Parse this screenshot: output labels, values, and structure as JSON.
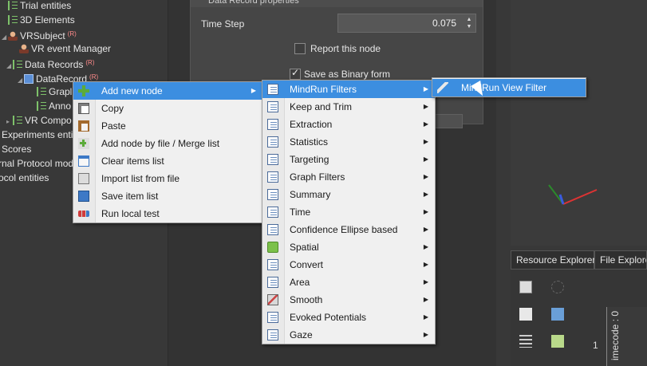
{
  "tree": {
    "items": [
      {
        "label": "Trial entities",
        "icon": "list-icon",
        "sup": ""
      },
      {
        "label": "3D Elements",
        "icon": "list-icon",
        "sup": ""
      },
      {
        "label": "VRSubject",
        "icon": "user-icon",
        "sup": "(R)"
      },
      {
        "label": "VR event Manager",
        "icon": "user-icon",
        "sup": ""
      },
      {
        "label": "Data Records",
        "icon": "list-icon",
        "sup": "(R)"
      },
      {
        "label": "DataRecord",
        "icon": "record-icon",
        "sup": "(R)"
      },
      {
        "label": "Grapl",
        "icon": "list-icon",
        "sup": ""
      },
      {
        "label": "Anno",
        "icon": "list-icon",
        "sup": ""
      },
      {
        "label": "VR Compo",
        "icon": "list-icon",
        "sup": ""
      },
      {
        "label": "Experiments entiti",
        "icon": "",
        "sup": ""
      },
      {
        "label": "Scores",
        "icon": "",
        "sup": ""
      },
      {
        "label": "rnal Protocol mod",
        "icon": "",
        "sup": ""
      },
      {
        "label": "ocol entities",
        "icon": "",
        "sup": ""
      }
    ]
  },
  "props": {
    "header": "Data Record properties",
    "time_step_label": "Time Step",
    "time_step_value": "0.075",
    "report_node_label": "Report this node",
    "report_node_checked": false,
    "binary_label": "Save as Binary form",
    "binary_checked": true
  },
  "context_menu": {
    "items": [
      {
        "label": "Add new node",
        "icon": "add-icon",
        "submenu": true,
        "highlighted": true
      },
      {
        "label": "Copy",
        "icon": "copy-icon",
        "submenu": false,
        "highlighted": false
      },
      {
        "label": "Paste",
        "icon": "paste-icon",
        "submenu": false,
        "highlighted": false
      },
      {
        "label": "Add node by file / Merge list",
        "icon": "add-file-icon",
        "submenu": false,
        "highlighted": false
      },
      {
        "label": "Clear items list",
        "icon": "clear-list-icon",
        "submenu": false,
        "highlighted": false
      },
      {
        "label": "Import list from file",
        "icon": "import-icon",
        "submenu": false,
        "highlighted": false
      },
      {
        "label": "Save item list",
        "icon": "save-icon",
        "submenu": false,
        "highlighted": false
      },
      {
        "label": "Run local test",
        "icon": "run-icon",
        "submenu": false,
        "highlighted": false
      }
    ]
  },
  "node_menu": {
    "items": [
      {
        "label": "MindRun Filters",
        "icon": "node-icon",
        "highlighted": true
      },
      {
        "label": "Keep and Trim",
        "icon": "node-icon",
        "highlighted": false
      },
      {
        "label": "Extraction",
        "icon": "node-icon",
        "highlighted": false
      },
      {
        "label": "Statistics",
        "icon": "node-icon",
        "highlighted": false
      },
      {
        "label": "Targeting",
        "icon": "node-icon",
        "highlighted": false
      },
      {
        "label": "Graph Filters",
        "icon": "node-icon",
        "highlighted": false
      },
      {
        "label": "Summary",
        "icon": "node-icon",
        "highlighted": false
      },
      {
        "label": "Time",
        "icon": "node-icon",
        "highlighted": false
      },
      {
        "label": "Confidence Ellipse based",
        "icon": "node-icon",
        "highlighted": false
      },
      {
        "label": "Spatial",
        "icon": "spatial-icon",
        "highlighted": false
      },
      {
        "label": "Convert",
        "icon": "node-icon",
        "highlighted": false
      },
      {
        "label": "Area",
        "icon": "node-icon",
        "highlighted": false
      },
      {
        "label": "Smooth",
        "icon": "smooth-icon",
        "highlighted": false
      },
      {
        "label": "Evoked Potentials",
        "icon": "node-icon",
        "highlighted": false
      },
      {
        "label": "Gaze",
        "icon": "node-icon",
        "highlighted": false
      }
    ]
  },
  "filter_menu": {
    "items": [
      {
        "label": "MindRun View Filter",
        "icon": "pen-icon",
        "highlighted": true
      }
    ]
  },
  "tabs": [
    {
      "label": "Resource Explorer"
    },
    {
      "label": "File Explore"
    }
  ],
  "timecode": {
    "label": "imecode : 0",
    "value": "1"
  },
  "colors": {
    "highlight": "#3c8ee0",
    "menu_bg": "#f0f0f0",
    "panel_bg": "#383838",
    "accent_red": "#ff8a8a"
  }
}
